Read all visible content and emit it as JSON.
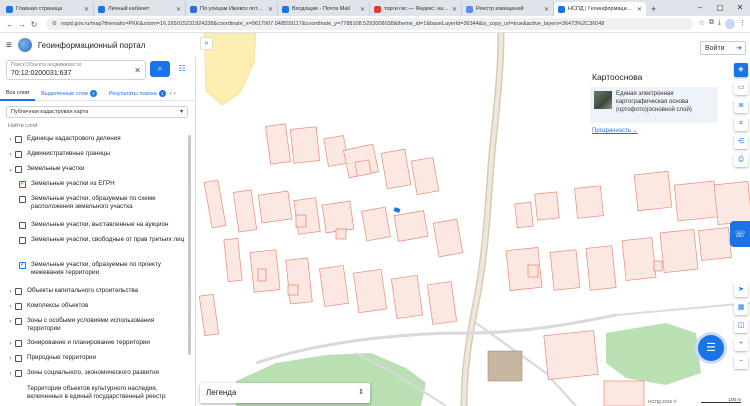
{
  "browser": {
    "tabs": [
      {
        "title": "Главная страница",
        "color": "#1b73e8",
        "active": false
      },
      {
        "title": "Личный кабинет",
        "color": "#1b73e8",
        "active": false
      },
      {
        "title": "По улицам Ижевск потекла...",
        "color": "#2a6fd6",
        "active": false
      },
      {
        "title": "Входящие - Почта Mail",
        "color": "#1b73e8",
        "active": false
      },
      {
        "title": "торги гис — Яндекс: нашлось...",
        "color": "#e53935",
        "active": false
      },
      {
        "title": "Реестр извещений",
        "color": "#5b8def",
        "active": false
      },
      {
        "title": "НСПД | Геоинформационный...",
        "color": "#1b73e8",
        "active": true
      }
    ],
    "url": "nspd.gov.ru/map?thematic=PKK&zoom=16.165015231924338&coordinate_x=9617907.048559117&coordinate_y=7788108.5293008038&theme_id=1&baseLayerId=36344&is_copy_url=true&active_layers=36473%2C36048"
  },
  "header": {
    "title": "Геоинформационный портал"
  },
  "search": {
    "label": "Поиск Объекта недвижимости",
    "value": "70:12:0200031:637"
  },
  "layer_tabs": {
    "all": "Все слои",
    "selected": "Выделенные слои",
    "selected_count": "3",
    "results": "Результаты поиска",
    "results_count": "1"
  },
  "basemap_select": "Публичная кадастровая карта",
  "find_layer_placeholder": "Найти слой",
  "tree": [
    {
      "type": "group",
      "label": "Единицы кадастрового деления",
      "checked": false,
      "indent": false
    },
    {
      "type": "group",
      "label": "Административные границы",
      "checked": false,
      "indent": false
    },
    {
      "type": "group-open",
      "label": "Земельные участки",
      "checked": false,
      "indent": false
    },
    {
      "type": "item",
      "label": "Земельные участки из ЕГРН",
      "checked": true,
      "indent": true
    },
    {
      "type": "item",
      "label": "Земельные участки, образуемые по схеме расположения земельного участка",
      "checked": false,
      "indent": true
    },
    {
      "type": "item",
      "label": "Земельные участки, выставленные на аукцион",
      "checked": false,
      "indent": true
    },
    {
      "type": "item",
      "label": "Земельные участки, свободные от прав третьих лиц",
      "checked": false,
      "indent": true
    },
    {
      "type": "item",
      "label": "Земельные участки, образуемые по проекту межевания территории",
      "checked": true,
      "indent": true
    },
    {
      "type": "group",
      "label": "Объекты капитального строительства",
      "checked": false,
      "indent": false
    },
    {
      "type": "group",
      "label": "Комплексы объектов",
      "checked": false,
      "indent": false
    },
    {
      "type": "group",
      "label": "Зоны с особыми условиями использования территории",
      "checked": false,
      "indent": false
    },
    {
      "type": "group",
      "label": "Зонирование и планирование территории",
      "checked": false,
      "indent": false
    },
    {
      "type": "group",
      "label": "Природные территории",
      "checked": false,
      "indent": false
    },
    {
      "type": "group",
      "label": "Зоны социального, экономического развития",
      "checked": false,
      "indent": false
    },
    {
      "type": "plain",
      "label": "Территории объектов культурного наследия, включенных в единый государственный реестр",
      "checked": false,
      "indent": false
    }
  ],
  "legend": "Легенда",
  "map": {
    "login": "Войти",
    "basemap_title": "Картооснова",
    "basemap_desc": "Единая электронная картографическая основа (ортофото)(основной слой)",
    "opacity": "Прозрачность",
    "copyright": "НСПД 2026 ©",
    "scale": "100 m"
  },
  "colors": {
    "accent": "#1b73e8",
    "parcel_fill": "#fce8e3",
    "parcel_stroke": "#e88a78",
    "forest": "#b9dfb3",
    "road": "#d7cbb6",
    "building": "#c8b7a0"
  }
}
